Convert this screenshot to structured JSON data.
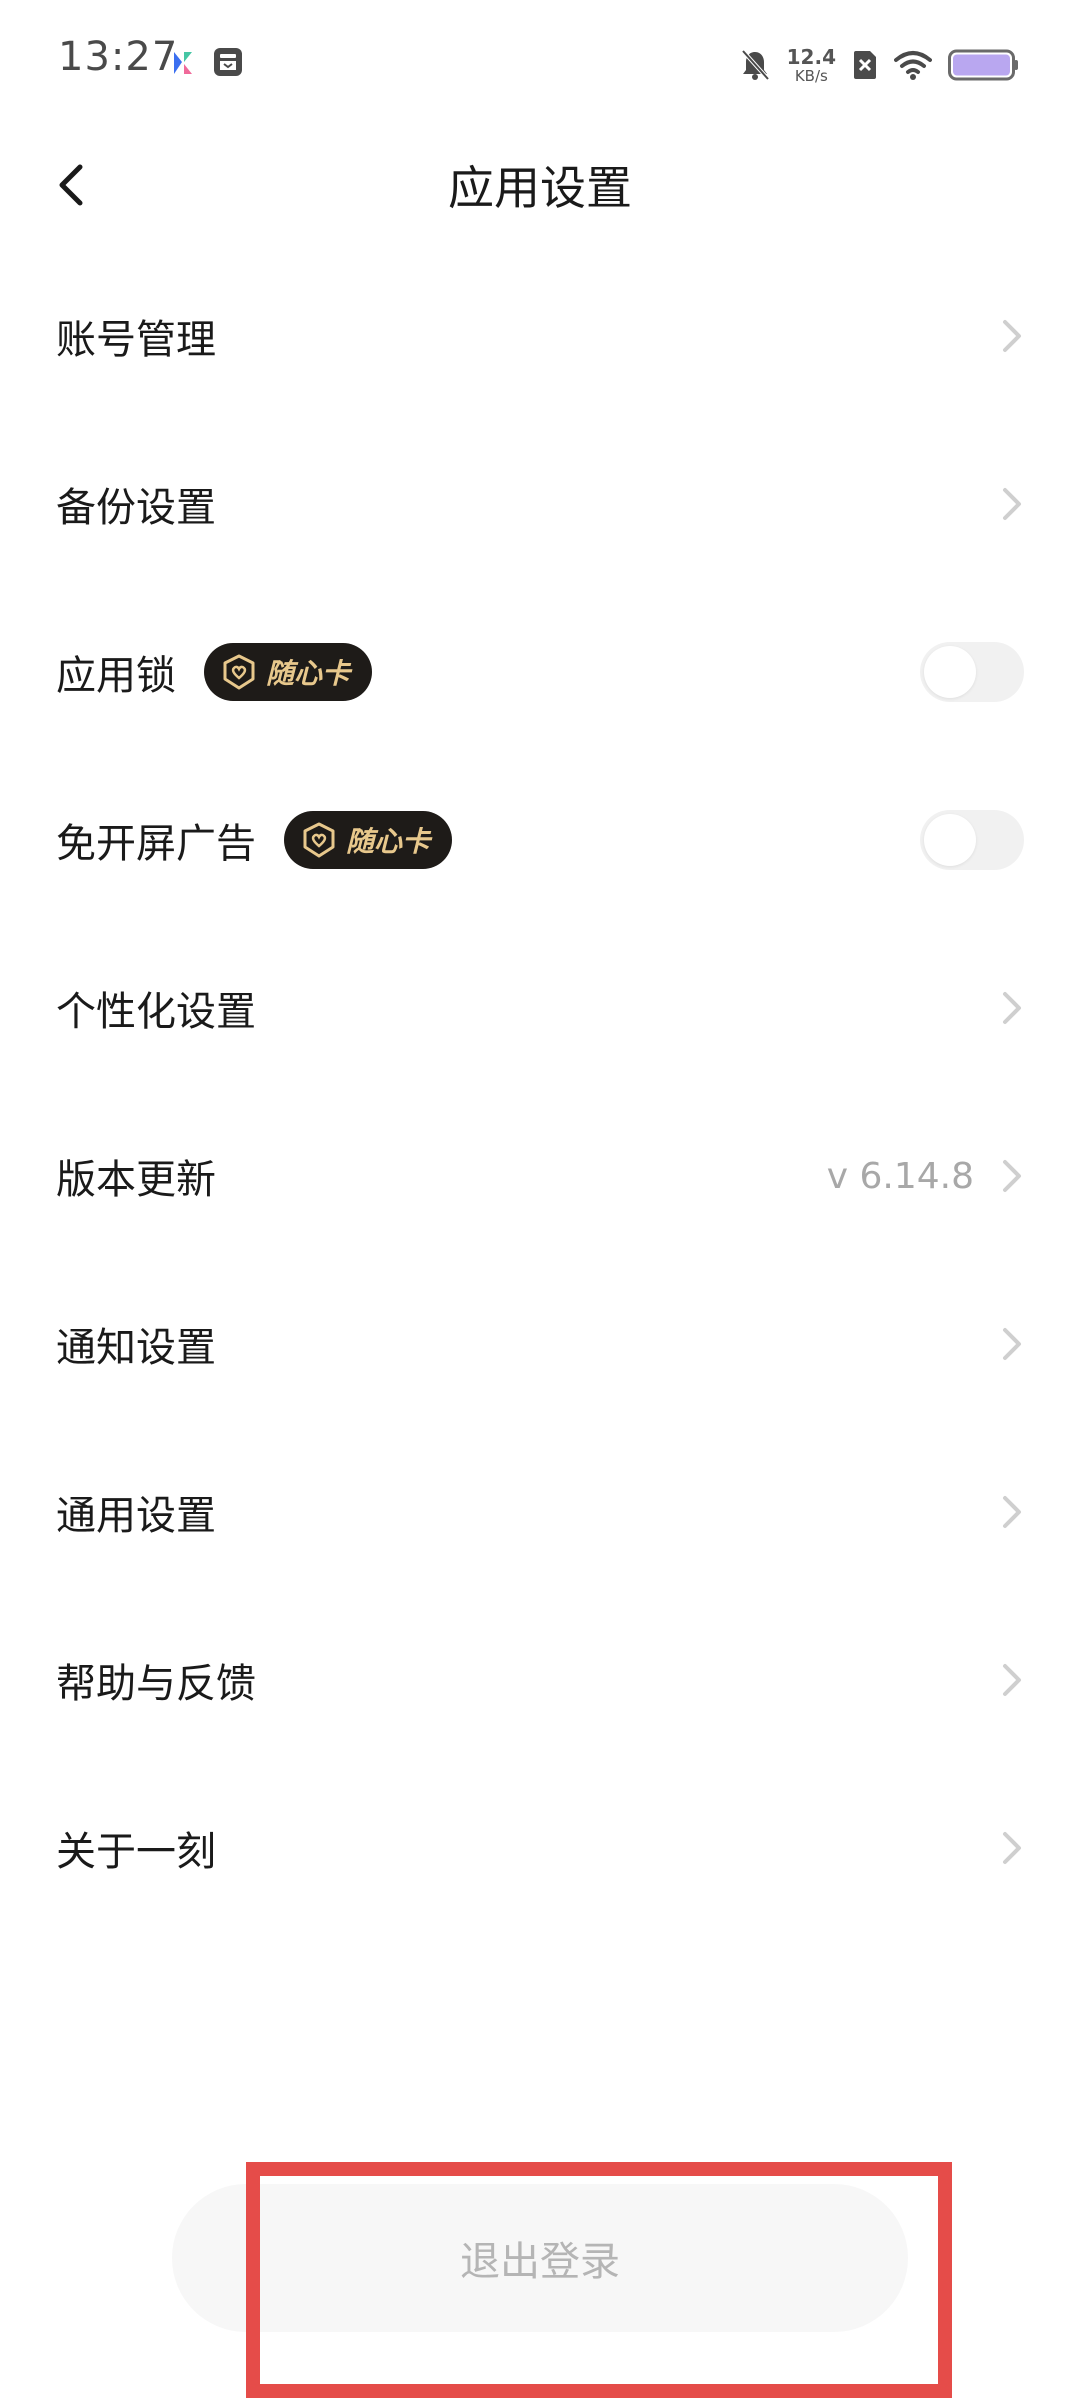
{
  "status_bar": {
    "time": "13:27",
    "net_speed_value": "12.4",
    "net_speed_unit": "KB/s",
    "battery_color": "#b9a7f0"
  },
  "header": {
    "title": "应用设置"
  },
  "settings": {
    "items": [
      {
        "label": "账号管理"
      },
      {
        "label": "备份设置"
      },
      {
        "label": "应用锁",
        "badge": "随心卡",
        "toggle_on": false
      },
      {
        "label": "免开屏广告",
        "badge": "随心卡",
        "toggle_on": false
      },
      {
        "label": "个性化设置"
      },
      {
        "label": "版本更新",
        "value": "v 6.14.8"
      },
      {
        "label": "通知设置"
      },
      {
        "label": "通用设置"
      },
      {
        "label": "帮助与反馈"
      },
      {
        "label": "关于一刻"
      }
    ]
  },
  "logout": {
    "label": "退出登录"
  },
  "colors": {
    "highlight_border": "#e54c49",
    "badge_bg": "#1e1b18",
    "badge_text": "#e8c88c"
  }
}
